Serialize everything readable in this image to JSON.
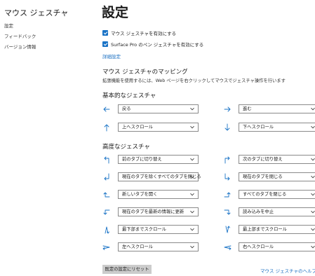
{
  "app": {
    "title": "マウス ジェスチャ"
  },
  "nav": {
    "items": [
      "設定",
      "フィードバック",
      "バージョン情報"
    ]
  },
  "page": {
    "title": "設定"
  },
  "options": {
    "enable_mouse_gestures": {
      "label": "マウス ジェスチャを有効にする",
      "checked": true
    },
    "enable_pen_gestures": {
      "label": "Surface Pro のペン ジェスチャを有効にする",
      "checked": true
    },
    "advanced_link": "詳細設定"
  },
  "mapping": {
    "title": "マウス ジェスチャのマッピング",
    "description": "拡張機能を使用するには、Web ページを右クリックしてマウスでジェスチャ操作を行います"
  },
  "basic": {
    "title": "基本的なジェスチャ",
    "items": [
      {
        "icon": "arrow-left-icon",
        "value": "戻る"
      },
      {
        "icon": "arrow-right-icon",
        "value": "進む"
      },
      {
        "icon": "arrow-up-icon",
        "value": "上へスクロール"
      },
      {
        "icon": "arrow-down-icon",
        "value": "下へスクロール"
      }
    ]
  },
  "advanced": {
    "title": "高度なジェスチャ",
    "items": [
      {
        "icon": "up-left-gesture-icon",
        "value": "前のタブに切り替え"
      },
      {
        "icon": "up-right-gesture-icon",
        "value": "次のタブに切り替え"
      },
      {
        "icon": "down-left-gesture-icon",
        "value": "現在のタブを除くすべてのタブを閉じる"
      },
      {
        "icon": "down-right-gesture-icon",
        "value": "現在のタブを閉じる"
      },
      {
        "icon": "left-up-gesture-icon",
        "value": "新しいタブを開く"
      },
      {
        "icon": "right-up-gesture-icon",
        "value": "すべてのタブを閉じる"
      },
      {
        "icon": "left-down-gesture-icon",
        "value": "現在のタブを最新の情報に更新"
      },
      {
        "icon": "right-down-gesture-icon",
        "value": "読み込みを中止"
      },
      {
        "icon": "up-down-gesture-icon",
        "value": "最下部までスクロール"
      },
      {
        "icon": "down-up-gesture-icon",
        "value": "最上部までスクロール"
      },
      {
        "icon": "right-left-gesture-icon",
        "value": "左へスクロール"
      },
      {
        "icon": "left-right-gesture-icon",
        "value": "右へスクロール"
      }
    ]
  },
  "footer": {
    "reset_label": "既定の設定にリセット",
    "help_link": "マウス ジェスチャのヘルプ"
  },
  "colors": {
    "accent": "#1a73c6",
    "link": "#1a6fc2",
    "button": "#cccccc"
  }
}
